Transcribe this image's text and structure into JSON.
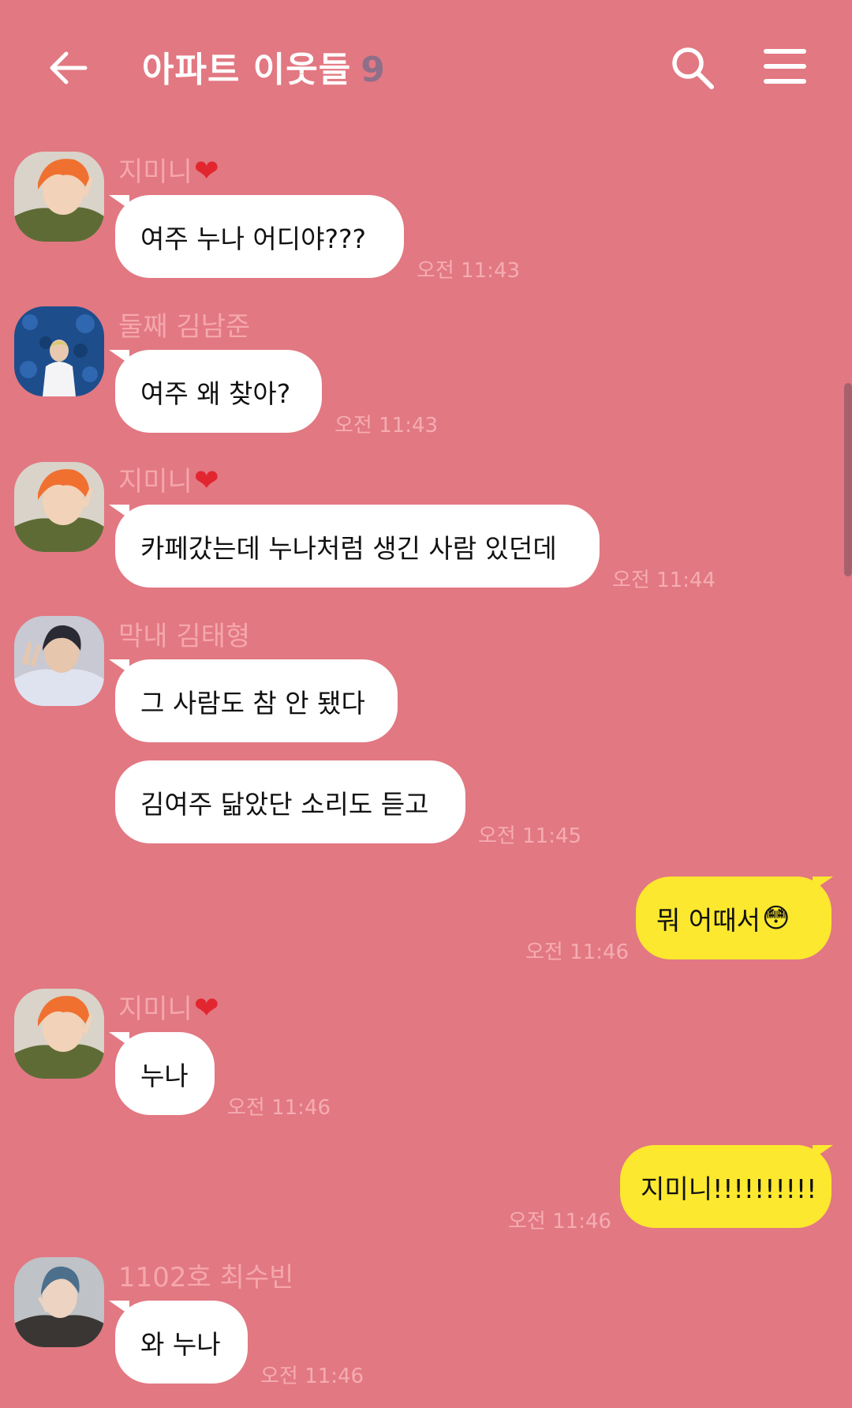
{
  "header": {
    "title": "아파트 이웃들",
    "member_count": "9"
  },
  "messages": [
    {
      "sender": "지미니",
      "text": "여주 누나 어디야???",
      "time": "오전 11:43"
    },
    {
      "sender": "둘째 김남준",
      "text": "여주 왜 찾아?",
      "time": "오전 11:43"
    },
    {
      "sender": "지미니",
      "text": "카페갔는데 누나처럼 생긴 사람 있던데",
      "time": "오전 11:44"
    },
    {
      "sender": "막내 김태형",
      "text": "그 사람도 참 안 됐다",
      "text2": "김여주 닮았단 소리도 듣고",
      "time": "오전 11:45"
    },
    {
      "text": "뭐 어때서",
      "emoji": "😳",
      "time": "오전 11:46"
    },
    {
      "sender": "지미니",
      "text": "누나",
      "time": "오전 11:46"
    },
    {
      "text": "지미니!!!!!!!!!!",
      "time": "오전 11:46"
    },
    {
      "sender": "1102호 최수빈",
      "text": "와 누나",
      "time": "오전 11:46"
    }
  ],
  "colors": {
    "background": "#e27882",
    "incoming_bubble": "#ffffff",
    "outgoing_bubble": "#fce82e",
    "sender_name": "#f5a7ac",
    "heart": "#e2262f"
  },
  "icons": [
    "back-arrow-icon",
    "search-icon",
    "menu-icon",
    "heart-icon"
  ]
}
